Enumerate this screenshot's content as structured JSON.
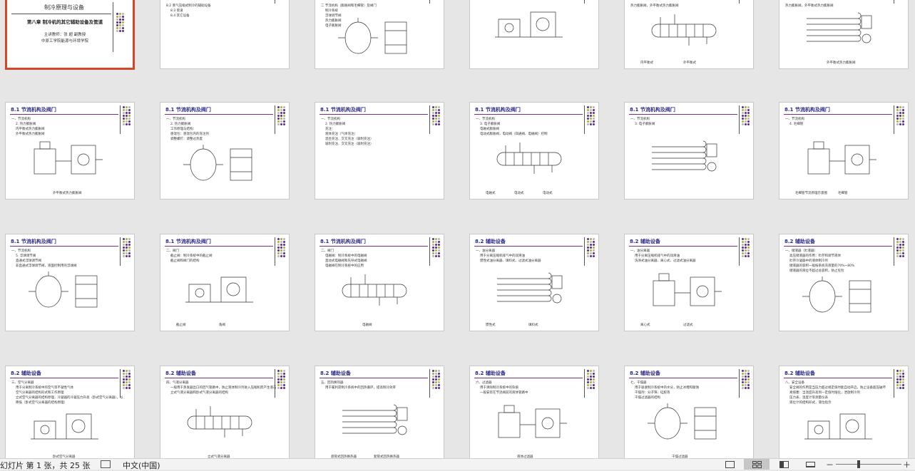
{
  "slides": [
    {
      "num": 1,
      "kind": "title",
      "title": "制冷原理与设备",
      "subtitle": "第八章 制冷机的其它辅助设备及管道",
      "author": "主讲教师：张  超 副教授",
      "school": "中原工学院能源与环境学院",
      "selected": true
    },
    {
      "num": 2,
      "kind": "toc",
      "bullets": [
        "8.2 蒸气压缩式制冷的辅助设备",
        "8.3 管道",
        "8.4 其它设备"
      ]
    },
    {
      "num": 3,
      "kind": "figure",
      "bullets": [
        "二  节流机构（膨胀阀和毛细管）及阀门",
        "制冷系统",
        "浮球调节阀",
        "热力膨胀阀",
        "电子膨胀阀",
        "毛细管",
        "截止阀与电磁阀"
      ]
    },
    {
      "num": 4,
      "kind": "figure",
      "bullets": []
    },
    {
      "num": 5,
      "kind": "figure",
      "bullets": [
        "热力膨胀阀，外平衡式热力膨胀阀"
      ],
      "captions": [
        "内平衡式",
        "外平衡式"
      ]
    },
    {
      "num": 6,
      "kind": "figure",
      "bullets": [
        "热力膨胀阀，外平衡式热力膨胀阀"
      ],
      "captions": [
        "外平衡式热力膨胀阀"
      ]
    },
    {
      "num": 7,
      "kind": "figure",
      "title": "8.1  节流机构及阀门",
      "bullets": [
        "一、节流机构",
        "2. 热力膨胀阀",
        "内平衡式热力膨胀阀",
        "外平衡式热力膨胀阀"
      ],
      "captions": [
        "外平衡式热力膨胀阀"
      ]
    },
    {
      "num": 8,
      "kind": "figure",
      "title": "8.1  节流机构及阀门",
      "bullets": [
        "一、节流机构",
        "2. 热力膨胀阀",
        "工作原理与结构：",
        "感温包：感温包内的充注剂",
        "调整螺钉：调整过热度",
        "平衡管：外平衡式",
        "温度传感器：感温包内的充注剂"
      ]
    },
    {
      "num": 9,
      "kind": "text",
      "title": "8.1  节流机构及阀门",
      "bullets": [
        "一、节流机构",
        "2. 热力膨胀阀",
        "充注：",
        "液体充注（气体充注）",
        "混合充注、交叉充注（吸附充注）",
        "吸附充注、交叉充注（吸附充注）"
      ]
    },
    {
      "num": 10,
      "kind": "figure",
      "title": "8.1  节流机构及阀门",
      "bullets": [
        "一、节流机构",
        "3. 电子膨胀阀",
        "电磁式膨胀阀",
        "电动式膨胀阀，电动阀（四通阀、电磁阀）控制"
      ],
      "captions": [
        "电磁式",
        "电动式",
        "电动式"
      ]
    },
    {
      "num": 11,
      "kind": "figure",
      "title": "8.1  节流机构及阀门",
      "bullets": [
        "一、节流机构",
        "3. 电子膨胀阀"
      ]
    },
    {
      "num": 12,
      "kind": "figure",
      "title": "8.1  节流机构及阀门",
      "bullets": [
        "一、节流机构",
        "4. 毛细管"
      ],
      "captions": [
        "毛细管节流原理示意图",
        "毛细管"
      ]
    },
    {
      "num": 13,
      "kind": "figure",
      "title": "8.1  节流机构及阀门",
      "bullets": [
        "一、节流机构",
        "5. 浮球调节阀",
        "直通式浮球调节阀",
        "非直通式浮球调节阀，液面控制用的浮球阀"
      ]
    },
    {
      "num": 14,
      "kind": "figure",
      "title": "8.1  节流机构及阀门",
      "bullets": [
        "二、阀门",
        "截止阀：制冷系统中的截止阀",
        "截止阀和阀门的结构"
      ],
      "captions": [
        "截止阀",
        "角阀"
      ]
    },
    {
      "num": 15,
      "kind": "figure",
      "title": "8.1  节流机构及阀门",
      "bullets": [
        "二、阀门",
        "电磁阀：制冷系统中的电磁阀",
        "直动式电磁阀和先导式电磁阀",
        "电磁阀在制冷系统中的应用"
      ],
      "captions": [
        "电磁阀"
      ]
    },
    {
      "num": 16,
      "kind": "figure",
      "title": "8.2  辅助设备",
      "bullets": [
        "一、油分离器",
        "用于分离压缩机排气中的润滑油",
        "惯性式油分离器、填料式、过滤式油分离器"
      ],
      "captions": [
        "惯性式",
        "填料式"
      ]
    },
    {
      "num": 17,
      "kind": "figure",
      "title": "8.2  辅助设备",
      "bullets": [
        "一、油分离器",
        "用于分离压缩机排气中的润滑油",
        "洗涤式油分离器、离心式、过滤式油分离器"
      ],
      "captions": [
        "离心式",
        "过滤式"
      ]
    },
    {
      "num": 18,
      "kind": "figure",
      "title": "8.2  辅助设备",
      "bullets": [
        "一、储液器（贮液器）",
        "高压储液器的作用：贮存和调节液体",
        "贮存冷凝器中的液体制冷剂",
        "储液器的容积一般按系统充液量的70%~80%",
        "储液器的液位不超过总容积，防止危险",
        "二、集油器",
        "用于收集从油分离器和冷凝器、冷凝器中放出的润滑油"
      ]
    },
    {
      "num": 19,
      "kind": "figure",
      "title": "8.2  辅助设备",
      "bullets": [
        "三、空气分离器",
        "用于分离制冷系统中的空气等不凝性气体",
        "空气分离器的结构形式和工作原理",
        "立式空气分离器的结构原理，冷凝器的冷凝压力升高（卧式空气分离器），以",
        "降低（卧式空气分离器的结构原理）"
      ],
      "captions": [
        "卧式空气分离器"
      ]
    },
    {
      "num": 20,
      "kind": "figure",
      "title": "8.2  辅助设备",
      "bullets": [
        "四、气液分离器",
        "一般用于蒸发器出口的回气管路中，防止液体制冷剂进入压缩机而产生液击",
        "立式气液分离器和卧式气液分离器的结构"
      ],
      "captions": [
        "立式气液分离器"
      ]
    },
    {
      "num": 21,
      "kind": "figure",
      "title": "8.2  辅助设备",
      "bullets": [
        "五、回热换热器",
        "用于氟利昂制冷系统中的回热循环，提高制冷效率"
      ],
      "captions": [
        "盘管式回热换热器",
        "套管式回热换热器"
      ]
    },
    {
      "num": 22,
      "kind": "figure",
      "title": "8.2  辅助设备",
      "bullets": [
        "六、过滤器",
        "用于清除制冷系统中的杂质",
        "一般安装在节流阀前的液体管路中"
      ],
      "captions": [
        "液体过滤器"
      ]
    },
    {
      "num": 23,
      "kind": "figure",
      "title": "8.2  辅助设备",
      "bullets": [
        "七、干燥器",
        "用于吸收制冷系统中的水分，防止冰堵和腐蚀",
        "干燥剂：分子筛、硅胶等",
        "干燥过滤器的结构"
      ],
      "captions": [
        "干燥过滤器"
      ]
    },
    {
      "num": 24,
      "kind": "figure",
      "title": "8.2  辅助设备",
      "bullets": [
        "八、安全设备",
        "安全阀的作用是当压力超过规定值时能自动开启，防止设备超压破坏",
        "易熔塞：当温度升高到一定值时熔化，泄放制冷剂",
        "压力表、温度计等测量仪表",
        "液位计的结构形式，液位指示"
      ]
    }
  ],
  "statusbar": {
    "slide_info": "幻灯片 第 1 张，共 25 张",
    "language": "中文(中国)",
    "zoom_minus": "－",
    "zoom_plus": "＋"
  },
  "colors": {
    "accent_title": "#2a2a8a",
    "selection_border": "#d24726",
    "rule_line": "#7b2c83",
    "dot_purple": "#5b2c8c",
    "dot_olive": "#a9b03a",
    "dot_gray": "#b5b5b5"
  }
}
